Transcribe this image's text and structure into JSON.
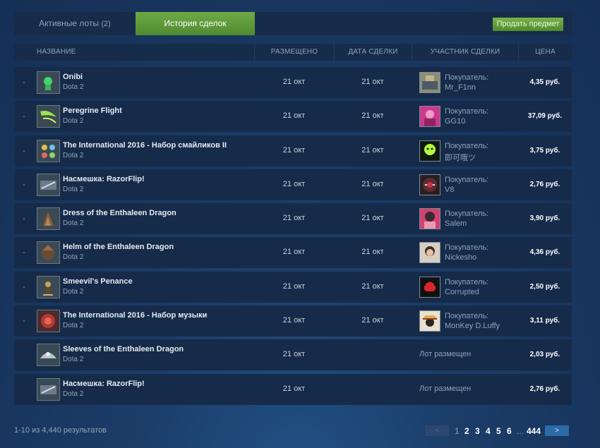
{
  "tabs": {
    "active_lots_label": "Активные лоты",
    "active_lots_count": "(2)",
    "history_label": "История сделок",
    "sell_button": "Продать предмет"
  },
  "columns": {
    "name": "НАЗВАНИЕ",
    "placed": "РАЗМЕЩЕНО",
    "date": "ДАТА СДЕЛКИ",
    "party": "УЧАСТНИК СДЕЛКИ",
    "price": "ЦЕНА"
  },
  "rows": [
    {
      "dash": "-",
      "name": "Onibi",
      "game": "Dota 2",
      "placed": "21 окт",
      "date": "21 окт",
      "role": "Покупатель:",
      "user": "Mr_F1nn",
      "price": "4,35 руб."
    },
    {
      "dash": "-",
      "name": "Peregrine Flight",
      "game": "Dota 2",
      "placed": "21 окт",
      "date": "21 окт",
      "role": "Покупатель:",
      "user": "GG10",
      "price": "37,09 руб."
    },
    {
      "dash": "-",
      "name": "The International 2016 - Набор смайликов II",
      "game": "Dota 2",
      "placed": "21 окт",
      "date": "21 окт",
      "role": "Покупатель:",
      "user": "即可哦ツ",
      "price": "3,75 руб."
    },
    {
      "dash": "-",
      "name": "Насмешка: RazorFlip!",
      "game": "Dota 2",
      "placed": "21 окт",
      "date": "21 окт",
      "role": "Покупатель:",
      "user": "V8",
      "price": "2,76 руб."
    },
    {
      "dash": "-",
      "name": "Dress of the Enthaleen Dragon",
      "game": "Dota 2",
      "placed": "21 окт",
      "date": "21 окт",
      "role": "Покупатель:",
      "user": "Salem",
      "price": "3,90 руб."
    },
    {
      "dash": "-",
      "name": "Helm of the Enthaleen Dragon",
      "game": "Dota 2",
      "placed": "21 окт",
      "date": "21 окт",
      "role": "Покупатель:",
      "user": "Nickesho",
      "price": "4,36 руб."
    },
    {
      "dash": "-",
      "name": "Smeevil's Penance",
      "game": "Dota 2",
      "placed": "21 окт",
      "date": "21 окт",
      "role": "Покупатель:",
      "user": "Corrupted",
      "price": "2,50 руб."
    },
    {
      "dash": "-",
      "name": "The International 2016 - Набор музыки",
      "game": "Dota 2",
      "placed": "21 окт",
      "date": "21 окт",
      "role": "Покупатель:",
      "user": "MonKey D.Luffy",
      "price": "3,11 руб."
    },
    {
      "dash": "",
      "name": "Sleeves of the Enthaleen Dragon",
      "game": "Dota 2",
      "placed": "21 окт",
      "listed": "Лот размещен",
      "price": "2,03 руб."
    },
    {
      "dash": "",
      "name": "Насмешка: RazorFlip!",
      "game": "Dota 2",
      "placed": "21 окт",
      "listed": "Лот размещен",
      "price": "2,76 руб."
    }
  ],
  "footer": {
    "results": "1-10 из 4,440 результатов",
    "prev": "<",
    "pages": [
      "1",
      "2",
      "3",
      "4",
      "5",
      "6"
    ],
    "dots": "...",
    "last": "444",
    "next": ">"
  }
}
